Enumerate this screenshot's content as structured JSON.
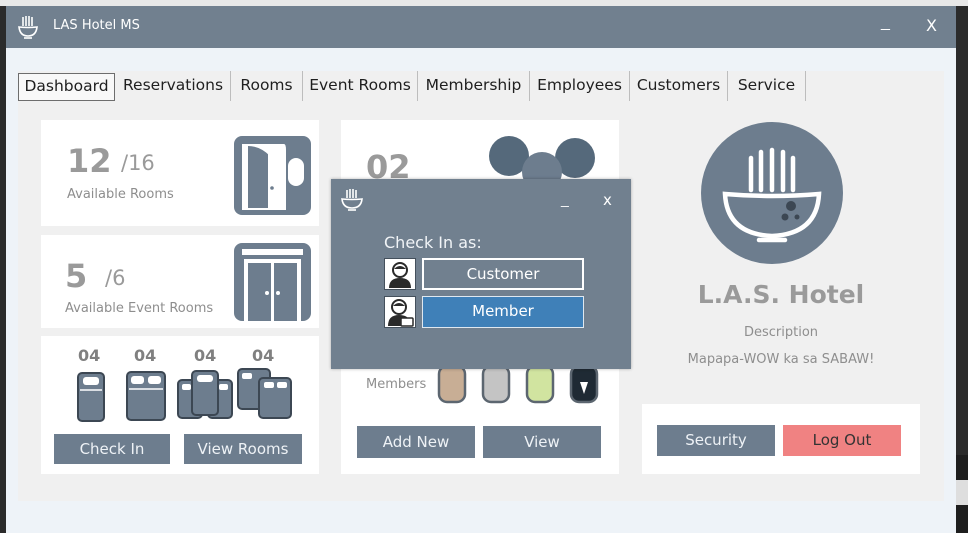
{
  "window": {
    "title": "LAS Hotel MS",
    "minimize_label": "_",
    "close_label": "X"
  },
  "tabs": [
    {
      "label": "Dashboard",
      "active": true
    },
    {
      "label": "Reservations"
    },
    {
      "label": "Rooms"
    },
    {
      "label": "Event Rooms"
    },
    {
      "label": "Membership"
    },
    {
      "label": "Employees"
    },
    {
      "label": "Customers"
    },
    {
      "label": "Service"
    }
  ],
  "rooms": {
    "available": "12",
    "total": "/16",
    "label": "Available Rooms"
  },
  "event_rooms": {
    "available": "5",
    "total": "/6",
    "label": "Available Event Rooms"
  },
  "room_types": {
    "counts": [
      "04",
      "04",
      "04",
      "04"
    ],
    "check_in_label": "Check In",
    "view_rooms_label": "View Rooms"
  },
  "members": {
    "count": "02",
    "label": "Members",
    "add_new_label": "Add New",
    "view_label": "View"
  },
  "hotel": {
    "name": "L.A.S. Hotel",
    "description_label": "Description",
    "description": "Mapapa-WOW ka sa SABAW!",
    "security_label": "Security",
    "logout_label": "Log Out"
  },
  "dialog": {
    "title": "Check In as:",
    "minimize_label": "_",
    "close_label": "x",
    "customer_label": "Customer",
    "member_label": "Member"
  },
  "colors": {
    "primary": "#6d7d8e",
    "titlebar": "#71808f",
    "member_button": "#3f80b8",
    "logout_button": "#f08282"
  }
}
